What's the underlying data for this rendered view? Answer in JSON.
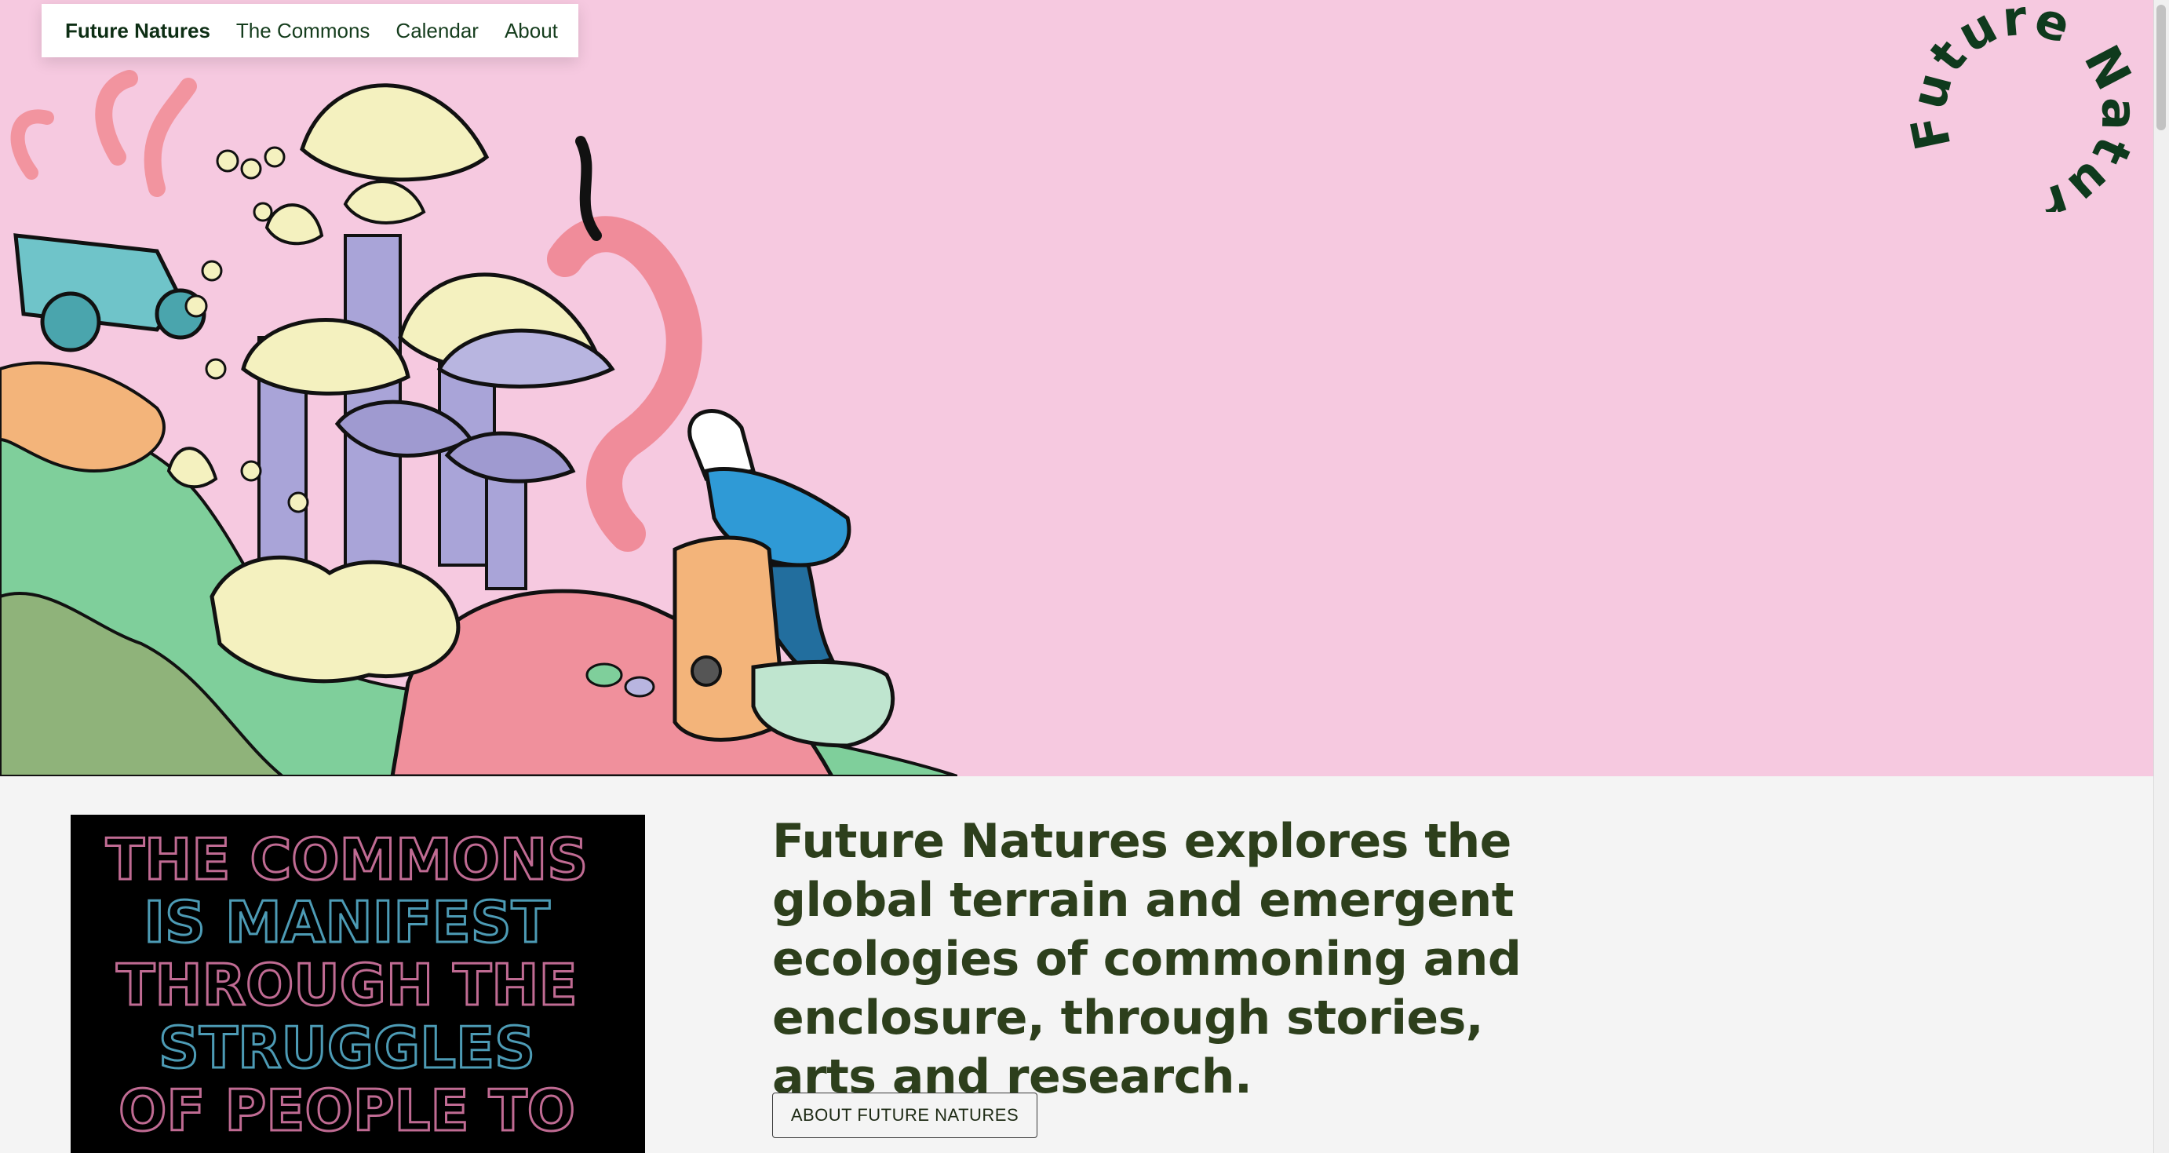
{
  "nav": {
    "brand": "Future Natures",
    "items": [
      {
        "label": "The Commons"
      },
      {
        "label": "Calendar"
      },
      {
        "label": "About"
      }
    ]
  },
  "logo": {
    "text": "Future Natures"
  },
  "poster": {
    "lines": [
      "THE COMMONS",
      "IS MANIFEST",
      "THROUGH THE",
      "STRUGGLES",
      "OF PEOPLE TO"
    ]
  },
  "intro": {
    "text": "Future Natures explores the global terrain and emergent ecologies of commoning and enclosure, through stories, arts and research.",
    "button_label": "ABOUT FUTURE NATURES"
  },
  "colors": {
    "hero_bg": "#f6c9e0",
    "brand_green": "#153d1d",
    "intro_text": "#2d3f1c",
    "page_bg": "#f4f4f4"
  }
}
